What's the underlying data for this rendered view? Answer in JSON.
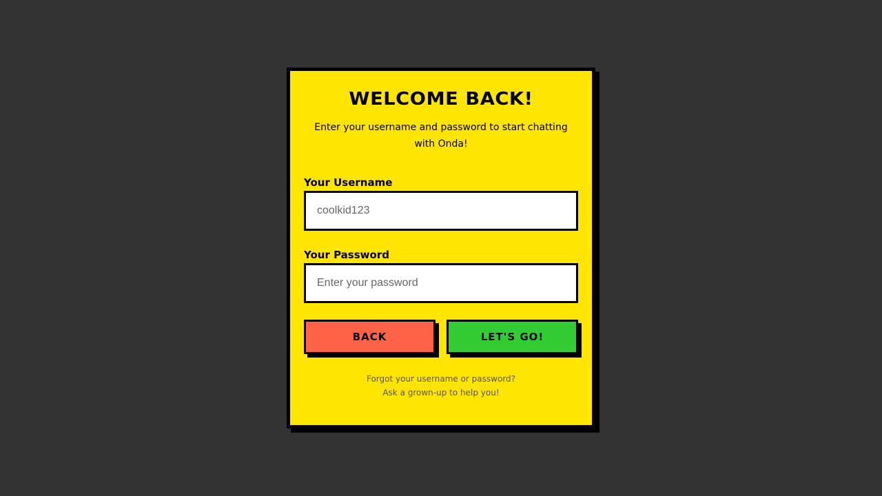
{
  "login": {
    "title": "WELCOME BACK!",
    "subtitle": "Enter your username and password to start chatting with Onda!",
    "username_label": "Your Username",
    "username_placeholder": "coolkid123",
    "password_label": "Your Password",
    "password_placeholder": "Enter your password",
    "back_label": "BACK",
    "go_label": "LET'S GO!",
    "help_line1": "Forgot your username or password?",
    "help_line2": "Ask a grown-up to help you!"
  },
  "colors": {
    "background": "#333333",
    "card": "#FFE500",
    "back_button": "#FF6347",
    "go_button": "#32CD32"
  }
}
